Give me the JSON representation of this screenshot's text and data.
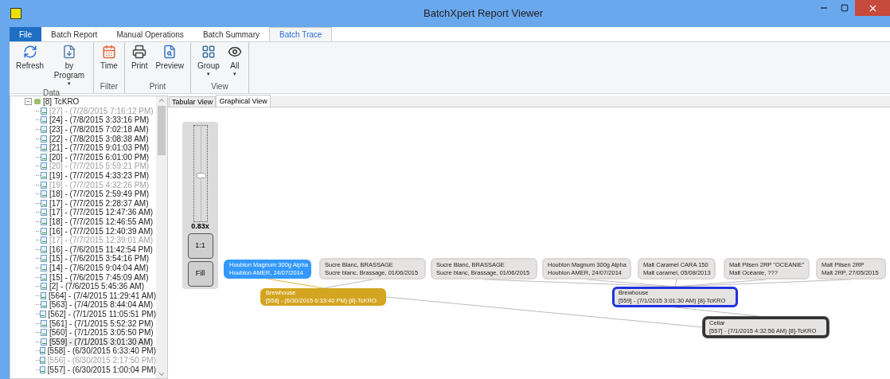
{
  "window": {
    "title": "BatchXpert Report Viewer"
  },
  "ribbon_tabs": [
    {
      "label": "File",
      "kind": "file",
      "selected": false
    },
    {
      "label": "Batch Report",
      "kind": "tab",
      "selected": false
    },
    {
      "label": "Manual Operations",
      "kind": "tab",
      "selected": false
    },
    {
      "label": "Batch Summary",
      "kind": "tab",
      "selected": false
    },
    {
      "label": "Batch Trace",
      "kind": "tab",
      "selected": true
    }
  ],
  "ribbon_groups": [
    {
      "label": "Data",
      "buttons": [
        {
          "label": "Refresh"
        },
        {
          "label": "by Program",
          "caret": "▾"
        }
      ]
    },
    {
      "label": "Filter",
      "buttons": [
        {
          "label": "Time"
        }
      ]
    },
    {
      "label": "Print",
      "buttons": [
        {
          "label": "Print"
        },
        {
          "label": "Preview"
        }
      ]
    },
    {
      "label": "View",
      "buttons": [
        {
          "label": "Group",
          "caret": "▾"
        },
        {
          "label": "All",
          "caret": "▾"
        }
      ]
    }
  ],
  "tree": {
    "label": "[8] TcKRO",
    "toggle": "−",
    "children": [
      {
        "label": "[27] - (7/28/2015 7:16:12 PM)",
        "disabled": true,
        "selected": false
      },
      {
        "label": "[24] - (7/8/2015 3:33:16 PM)",
        "disabled": false,
        "selected": false
      },
      {
        "label": "[23] - (7/8/2015 7:02:18 AM)",
        "disabled": false,
        "selected": false
      },
      {
        "label": "[22] - (7/8/2015 3:08:38 AM)",
        "disabled": false,
        "selected": false
      },
      {
        "label": "[21] - (7/7/2015 9:01:03 PM)",
        "disabled": false,
        "selected": false
      },
      {
        "label": "[20] - (7/7/2015 6:01:00 PM)",
        "disabled": false,
        "selected": false
      },
      {
        "label": "[20] - (7/7/2015 5:59:21 PM)",
        "disabled": true,
        "selected": false
      },
      {
        "label": "[19] - (7/7/2015 4:33:23 PM)",
        "disabled": false,
        "selected": false
      },
      {
        "label": "[19] - (7/7/2015 4:32:26 PM)",
        "disabled": true,
        "selected": false
      },
      {
        "label": "[18] - (7/7/2015 2:59:49 PM)",
        "disabled": false,
        "selected": false
      },
      {
        "label": "[17] - (7/7/2015 2:28:37 AM)",
        "disabled": false,
        "selected": false
      },
      {
        "label": "[17] - (7/7/2015 12:47:36 AM)",
        "disabled": false,
        "selected": false
      },
      {
        "label": "[18] - (7/7/2015 12:46:55 AM)",
        "disabled": false,
        "selected": false
      },
      {
        "label": "[16] - (7/7/2015 12:40:39 AM)",
        "disabled": false,
        "selected": false
      },
      {
        "label": "[17] - (7/7/2015 12:39:01 AM)",
        "disabled": true,
        "selected": false
      },
      {
        "label": "[16] - (7/6/2015 11:42:54 PM)",
        "disabled": false,
        "selected": false
      },
      {
        "label": "[15] - (7/6/2015 3:54:16 PM)",
        "disabled": false,
        "selected": false
      },
      {
        "label": "[14] - (7/6/2015 9:04:04 AM)",
        "disabled": false,
        "selected": false
      },
      {
        "label": "[15] - (7/6/2015 7:45:09 AM)",
        "disabled": false,
        "selected": false
      },
      {
        "label": "[2] - (7/6/2015 5:45:36 AM)",
        "disabled": false,
        "selected": false
      },
      {
        "label": "[564] - (7/4/2015 11:29:41 AM)",
        "disabled": false,
        "selected": false
      },
      {
        "label": "[563] - (7/4/2015 8:44:04 AM)",
        "disabled": false,
        "selected": false
      },
      {
        "label": "[562] - (7/1/2015 11:05:51 PM)",
        "disabled": false,
        "selected": false
      },
      {
        "label": "[561] - (7/1/2015 5:52:32 PM)",
        "disabled": false,
        "selected": false
      },
      {
        "label": "[560] - (7/1/2015 3:05:50 PM)",
        "disabled": false,
        "selected": false
      },
      {
        "label": "[559] - (7/1/2015 3:01:30 AM)",
        "disabled": false,
        "selected": true
      },
      {
        "label": "[558] - (6/30/2015 6:33:40 PM)",
        "disabled": false,
        "selected": false
      },
      {
        "label": "[556] - (6/30/2015 2:17:50 PM)",
        "disabled": true,
        "selected": false
      },
      {
        "label": "[557] - (6/30/2015 1:00:04 PM)",
        "disabled": false,
        "selected": false
      }
    ]
  },
  "view_tabs": [
    {
      "label": "Tabular View",
      "selected": false
    },
    {
      "label": "Graphical View",
      "selected": true
    }
  ],
  "zoom": {
    "level": 0.48,
    "reading": "0.83x",
    "buttons": [
      "1:1",
      "Fill"
    ]
  },
  "graph": {
    "nodes": [
      {
        "lines": [
          "Houblon Magnum 300g Alpha",
          "Houblon AMER, 24/07/2014"
        ],
        "color": "#3399ff",
        "selected": false,
        "focused": false
      },
      {
        "lines": [
          "Sucre Blanc, BRASSAGE",
          "Sucre blanc, Brassage, 01/06/2015"
        ],
        "color": "#e6e3e3",
        "selected": false,
        "focused": false
      },
      {
        "lines": [
          "Sucre Blanc, BRASSAGE",
          "Sucre blanc, Brassage, 01/06/2015"
        ],
        "color": "#e6e3e3",
        "selected": false,
        "focused": false
      },
      {
        "lines": [
          "Houblon Magnum 300g Alpha",
          "Houblon AMER, 24/07/2014"
        ],
        "color": "#e6e3e3",
        "selected": false,
        "focused": false
      },
      {
        "lines": [
          "Malt Caramel CARA 150",
          "Malt caramel, 05/08/2013"
        ],
        "color": "#e6e3e3",
        "selected": false,
        "focused": false
      },
      {
        "lines": [
          "Malt Pilsen 2RP \"OCEANIE\"",
          "Malt Océanie, ???"
        ],
        "color": "#e6e3e3",
        "selected": false,
        "focused": false
      },
      {
        "lines": [
          "Malt Pilsen 2RP",
          "Malt 2RP, 27/05/2015"
        ],
        "color": "#e6e3e3",
        "selected": false,
        "focused": false
      },
      {
        "lines": [
          "Brewhouse",
          "[558] - (6/30/2015 6:33:40 PM)  [8]-TcKRO"
        ],
        "color": "#d4a520",
        "selected": false,
        "focused": false
      },
      {
        "lines": [
          "Brewhouse",
          "[559] - (7/1/2015 3:01:30 AM)  [8]-TcKRO"
        ],
        "color": "#e6e3e3",
        "selected": true,
        "focused": false
      },
      {
        "lines": [
          "Cellar",
          "[557] - (7/1/2015 4:32:56 AM)  [8]-TcKRO"
        ],
        "color": "#e6e3e3",
        "selected": false,
        "focused": true
      }
    ]
  }
}
